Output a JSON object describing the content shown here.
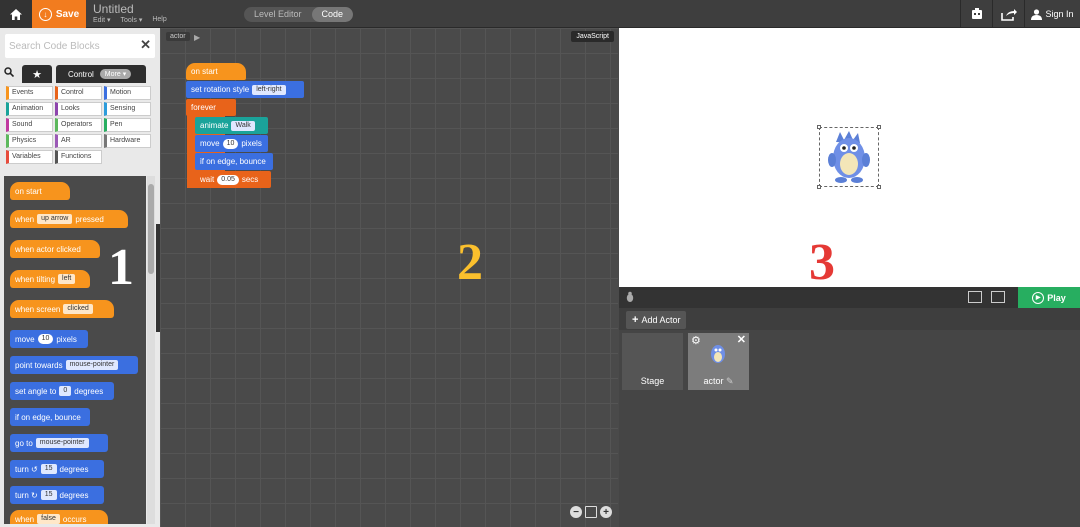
{
  "topbar": {
    "save_label": "Save",
    "project_title": "Untitled",
    "menus": [
      "Edit ▾",
      "Tools ▾",
      "Help"
    ],
    "mode_tabs": [
      "Level Editor",
      "Code"
    ],
    "active_mode": "Code",
    "sign_in": "Sign In"
  },
  "toolbox": {
    "search_placeholder": "Search Code Blocks",
    "tab_control": "Control",
    "more_label": "More ▾",
    "categories": [
      {
        "label": "Events",
        "color": "#f7941d"
      },
      {
        "label": "Control",
        "color": "#e8631a"
      },
      {
        "label": "Motion",
        "color": "#3b6fe0"
      },
      {
        "label": "Animation",
        "color": "#1aa39a"
      },
      {
        "label": "Looks",
        "color": "#8e44ad"
      },
      {
        "label": "Sensing",
        "color": "#2d9cdb"
      },
      {
        "label": "Sound",
        "color": "#c0399f"
      },
      {
        "label": "Operators",
        "color": "#5cb85c"
      },
      {
        "label": "Pen",
        "color": "#27ae60"
      },
      {
        "label": "Physics",
        "color": "#5cb85c"
      },
      {
        "label": "AR",
        "color": "#9b59b6"
      },
      {
        "label": "Hardware",
        "color": "#777777"
      },
      {
        "label": "Variables",
        "color": "#e74c3c"
      },
      {
        "label": "Functions",
        "color": "#555555"
      }
    ],
    "palette": {
      "on_start": "on start",
      "when_key_a": "when",
      "when_key_val": "up arrow",
      "when_key_b": "pressed",
      "when_actor_clicked": "when actor clicked",
      "when_tilting_a": "when tilting",
      "when_tilting_val": "left",
      "when_screen_a": "when screen",
      "when_screen_val": "clicked",
      "move_a": "move",
      "move_val": "10",
      "move_b": "pixels",
      "point_a": "point towards",
      "point_val": "mouse-pointer",
      "angle_a": "set angle to",
      "angle_val": "0",
      "angle_b": "degrees",
      "edge_bounce": "if on edge, bounce",
      "goto_a": "go to",
      "goto_val": "mouse-pointer",
      "turn_a": "turn",
      "turn_val": "15",
      "turn_b": "degrees",
      "turn2_a": "turn",
      "turn2_val": "15",
      "turn2_b": "degrees",
      "when_false_a": "when",
      "when_false_val": "false",
      "when_false_b": "occurs"
    },
    "section_number": "1"
  },
  "workspace": {
    "breadcrumb": "actor",
    "js_button": "JavaScript",
    "on_start": "on start",
    "rotation_a": "set rotation style",
    "rotation_val": "left-right",
    "forever": "forever",
    "animate_a": "animate",
    "animate_val": "Walk",
    "move_a": "move",
    "move_val": "10",
    "move_b": "pixels",
    "edge_bounce": "if on edge, bounce",
    "wait_a": "wait",
    "wait_val": "0.05",
    "wait_b": "secs",
    "section_number": "2"
  },
  "stage": {
    "section_number": "3",
    "play_label": "Play"
  },
  "actors": {
    "add_actor": "Add Actor",
    "stage_label": "Stage",
    "actor_label": "actor"
  },
  "colors": {
    "save": "#f27c1f",
    "event_block": "#f7941d",
    "motion_block": "#3b6fe0",
    "control_block": "#e8631a",
    "animation_block": "#1aa39a",
    "play": "#27ae60"
  }
}
